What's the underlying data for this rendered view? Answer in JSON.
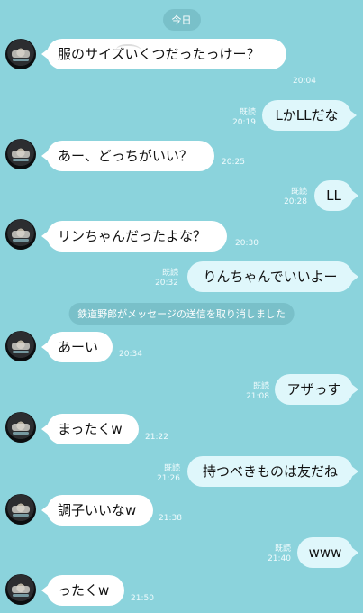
{
  "header": {
    "date_label": "今日"
  },
  "system": {
    "unsent_notice": "鉄道野郎がメッセージの送信を取り消しました"
  },
  "messages": [
    {
      "side": "in",
      "text": "服のサイズいくつだったっけー？",
      "time": "20:04",
      "read": ""
    },
    {
      "side": "out",
      "text": "LかLLだな",
      "time": "20:19",
      "read": "既読"
    },
    {
      "side": "in",
      "text": "あー、どっちがいい？",
      "time": "20:25",
      "read": ""
    },
    {
      "side": "out",
      "text": "LL",
      "time": "20:28",
      "read": "既読"
    },
    {
      "side": "in",
      "text": "リンちゃんだったよな？",
      "time": "20:30",
      "read": ""
    },
    {
      "side": "out",
      "text": "りんちゃんでいいよー",
      "time": "20:32",
      "read": "既読"
    },
    {
      "side": "in",
      "text": "あーい",
      "time": "20:34",
      "read": ""
    },
    {
      "side": "out",
      "text": "アザっす",
      "time": "21:08",
      "read": "既読"
    },
    {
      "side": "in",
      "text": "まったくw",
      "time": "21:22",
      "read": ""
    },
    {
      "side": "out",
      "text": "持つべきものは友だね",
      "time": "21:26",
      "read": "既読"
    },
    {
      "side": "in",
      "text": "調子いいなw",
      "time": "21:38",
      "read": ""
    },
    {
      "side": "out",
      "text": "www",
      "time": "21:40",
      "read": "既読"
    },
    {
      "side": "in",
      "text": "ったくw",
      "time": "21:50",
      "read": ""
    }
  ],
  "colors": {
    "background": "#8bd3dc",
    "incoming_bubble": "#ffffff",
    "outgoing_bubble": "#dff7fb",
    "pill": "#79c0c9"
  }
}
